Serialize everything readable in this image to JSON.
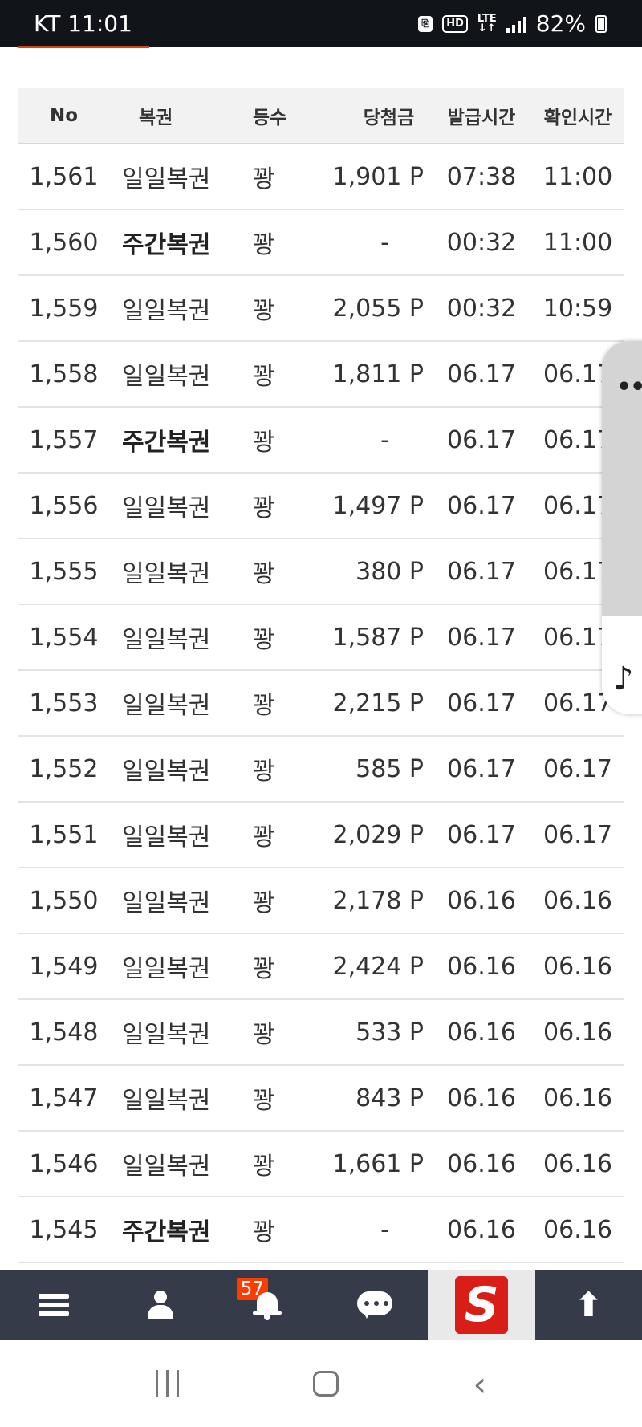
{
  "status_bar": {
    "carrier": "KT",
    "time": "11:01",
    "battery": "82%",
    "network": "LTE"
  },
  "table": {
    "headers": [
      "No",
      "복권",
      "등수",
      "당첨금",
      "발급시간",
      "확인시간"
    ],
    "rows": [
      {
        "no": "1,561",
        "name": "일일복권",
        "rank": "꽝",
        "prize": "1,901 P",
        "issued": "07:38",
        "checked": "11:00",
        "bold": false
      },
      {
        "no": "1,560",
        "name": "주간복권",
        "rank": "꽝",
        "prize": "-",
        "issued": "00:32",
        "checked": "11:00",
        "bold": true
      },
      {
        "no": "1,559",
        "name": "일일복권",
        "rank": "꽝",
        "prize": "2,055 P",
        "issued": "00:32",
        "checked": "10:59",
        "bold": false
      },
      {
        "no": "1,558",
        "name": "일일복권",
        "rank": "꽝",
        "prize": "1,811 P",
        "issued": "06.17",
        "checked": "06.17",
        "bold": false
      },
      {
        "no": "1,557",
        "name": "주간복권",
        "rank": "꽝",
        "prize": "-",
        "issued": "06.17",
        "checked": "06.17",
        "bold": true
      },
      {
        "no": "1,556",
        "name": "일일복권",
        "rank": "꽝",
        "prize": "1,497 P",
        "issued": "06.17",
        "checked": "06.17",
        "bold": false
      },
      {
        "no": "1,555",
        "name": "일일복권",
        "rank": "꽝",
        "prize": "380 P",
        "issued": "06.17",
        "checked": "06.17",
        "bold": false
      },
      {
        "no": "1,554",
        "name": "일일복권",
        "rank": "꽝",
        "prize": "1,587 P",
        "issued": "06.17",
        "checked": "06.17",
        "bold": false
      },
      {
        "no": "1,553",
        "name": "일일복권",
        "rank": "꽝",
        "prize": "2,215 P",
        "issued": "06.17",
        "checked": "06.17",
        "bold": false
      },
      {
        "no": "1,552",
        "name": "일일복권",
        "rank": "꽝",
        "prize": "585 P",
        "issued": "06.17",
        "checked": "06.17",
        "bold": false
      },
      {
        "no": "1,551",
        "name": "일일복권",
        "rank": "꽝",
        "prize": "2,029 P",
        "issued": "06.17",
        "checked": "06.17",
        "bold": false
      },
      {
        "no": "1,550",
        "name": "일일복권",
        "rank": "꽝",
        "prize": "2,178 P",
        "issued": "06.16",
        "checked": "06.16",
        "bold": false
      },
      {
        "no": "1,549",
        "name": "일일복권",
        "rank": "꽝",
        "prize": "2,424 P",
        "issued": "06.16",
        "checked": "06.16",
        "bold": false
      },
      {
        "no": "1,548",
        "name": "일일복권",
        "rank": "꽝",
        "prize": "533 P",
        "issued": "06.16",
        "checked": "06.16",
        "bold": false
      },
      {
        "no": "1,547",
        "name": "일일복권",
        "rank": "꽝",
        "prize": "843 P",
        "issued": "06.16",
        "checked": "06.16",
        "bold": false
      },
      {
        "no": "1,546",
        "name": "일일복권",
        "rank": "꽝",
        "prize": "1,661 P",
        "issued": "06.16",
        "checked": "06.16",
        "bold": false
      },
      {
        "no": "1,545",
        "name": "주간복권",
        "rank": "꽝",
        "prize": "-",
        "issued": "06.16",
        "checked": "06.16",
        "bold": true
      }
    ]
  },
  "toolbar": {
    "items": [
      {
        "icon": "menu-icon"
      },
      {
        "icon": "user-icon"
      },
      {
        "icon": "bell-icon",
        "badge": "57"
      },
      {
        "icon": "chat-icon"
      },
      {
        "icon": "logo-s-icon",
        "logo_text": "S"
      },
      {
        "icon": "arrow-up-icon"
      }
    ],
    "colors": {
      "background": "#353b48",
      "badge": "#ff3b00",
      "logo": "#d91e18"
    }
  },
  "side_panel": {
    "icons": [
      "more-dots-icon",
      "music-note-icon"
    ]
  },
  "navbar": {
    "icons": [
      "recents-icon",
      "home-icon",
      "back-icon"
    ]
  }
}
